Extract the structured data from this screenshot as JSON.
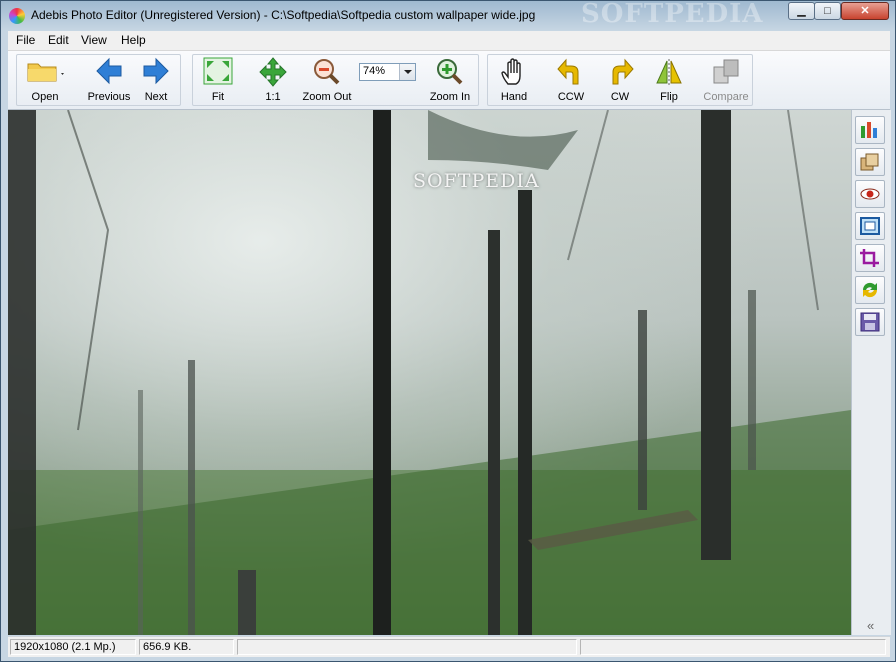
{
  "window": {
    "title": "Adebis Photo Editor (Unregistered Version) - C:\\Softpedia\\Softpedia custom wallpaper wide.jpg",
    "watermark": "SOFTPEDIA",
    "controls": {
      "minimize": "▁",
      "maximize": "□",
      "close": "✕"
    }
  },
  "menu": {
    "items": [
      "File",
      "Edit",
      "View",
      "Help"
    ]
  },
  "toolbar": {
    "open_label": "Open",
    "previous_label": "Previous",
    "next_label": "Next",
    "fit_label": "Fit",
    "one_to_one_label": "1:1",
    "zoom_out_label": "Zoom Out",
    "zoom_value": "74%",
    "zoom_in_label": "Zoom In",
    "hand_label": "Hand",
    "ccw_label": "CCW",
    "cw_label": "CW",
    "flip_label": "Flip",
    "compare_label": "Compare"
  },
  "canvas": {
    "image_watermark": "SOFTPEDIA"
  },
  "side_panel": {
    "tools": [
      "histogram-icon",
      "layers-icon",
      "red-eye-icon",
      "frame-icon",
      "crop-icon",
      "refresh-icon",
      "save-icon"
    ],
    "collapse": "«"
  },
  "status": {
    "dimensions": "1920x1080 (2.1 Mp.)",
    "file_size": "656.9 KB."
  },
  "colors": {
    "title_gradient_top": "#9fb9d0",
    "close_button": "#c8432f",
    "arrow_blue": "#2f7fd6",
    "fit_green": "#3aa63a"
  }
}
